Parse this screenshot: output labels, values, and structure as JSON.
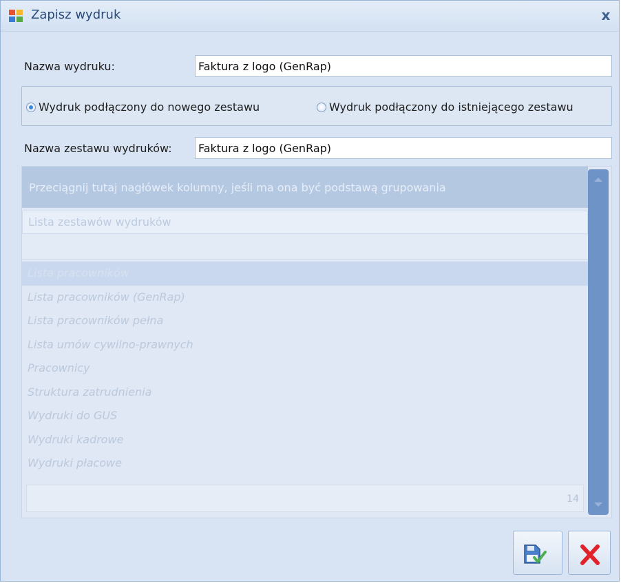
{
  "window": {
    "title": "Zapisz wydruk"
  },
  "form": {
    "print_name_label": "Nazwa wydruku:",
    "print_name_value": "Faktura z logo (GenRap)",
    "set_name_label": "Nazwa zestawu wydruków:",
    "set_name_value": "Faktura z logo (GenRap)"
  },
  "radio": {
    "option_new": {
      "label": "Wydruk podłączony do nowego zestawu",
      "selected": true
    },
    "option_existing": {
      "label": "Wydruk podłączony do istniejącego zestawu",
      "selected": false
    }
  },
  "grid": {
    "group_panel_text": "Przeciągnij tutaj nagłówek kolumny, jeśli ma ona być podstawą grupowania",
    "column_header": "Lista zestawów wydruków",
    "rows": [
      "Lista pracowników",
      "Lista pracowników (GenRap)",
      "Lista pracowników pełna",
      "Lista umów cywilno-prawnych",
      "Pracownicy",
      "Struktura zatrudnienia",
      "Wydruki do GUS",
      "Wydruki kadrowe",
      "Wydruki płacowe"
    ],
    "selected_row": 0,
    "footer_count": "14"
  },
  "colors": {
    "accent": "#3d88d6",
    "scrollbar": "#6e93c7",
    "cancel_red": "#e0232a",
    "confirm_green": "#4caf50"
  }
}
